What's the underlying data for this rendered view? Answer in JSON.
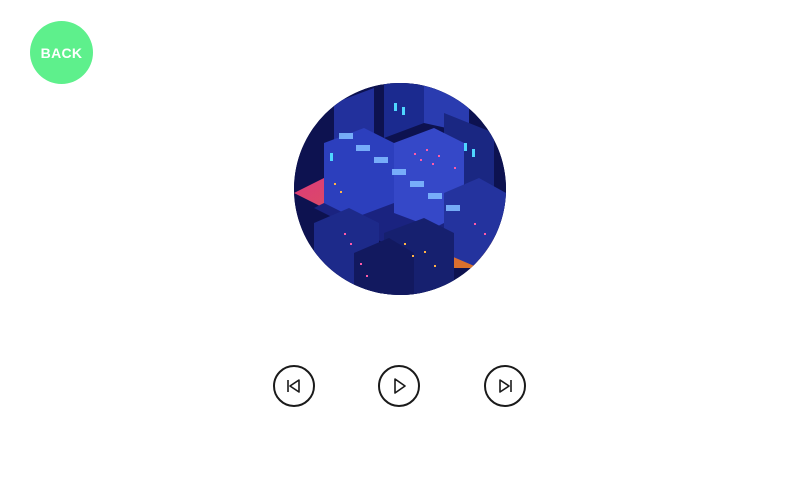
{
  "back_button": {
    "label": "BACK",
    "color": "#5ef08c"
  },
  "album_cover": {
    "description_icon": "isometric-city-artwork"
  },
  "controls": {
    "previous": {
      "icon": "skip-previous-icon"
    },
    "play": {
      "icon": "play-icon"
    },
    "next": {
      "icon": "skip-next-icon"
    }
  },
  "colors": {
    "background": "#ffffff",
    "control_stroke": "#1a1a1a",
    "cover_dark": "#0d1250",
    "cover_orange": "#ff7a1a",
    "cover_pink": "#ff3d8a",
    "cover_cyan": "#4fd6ff"
  }
}
